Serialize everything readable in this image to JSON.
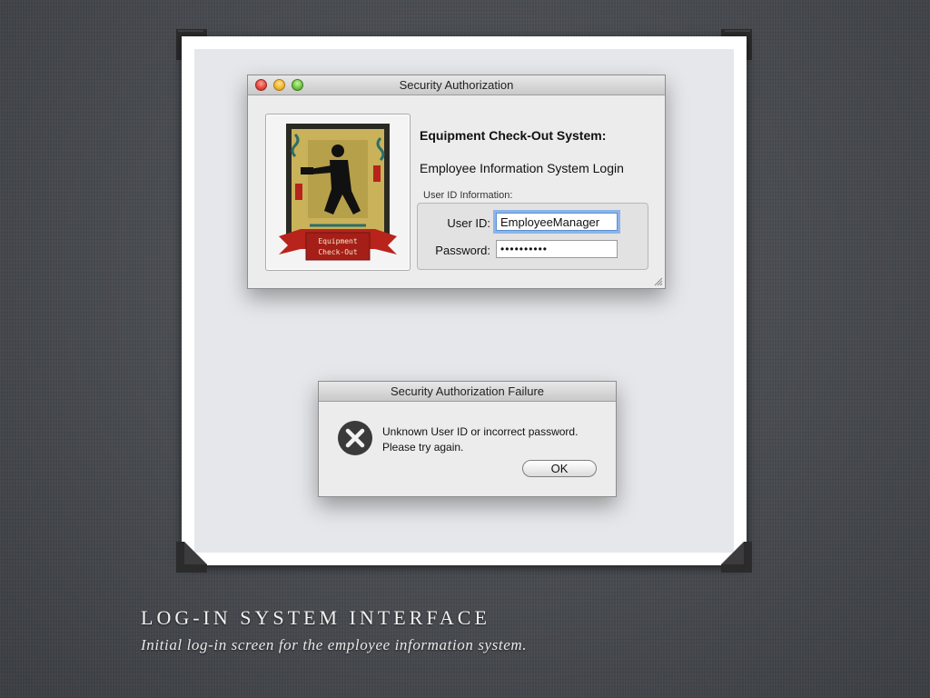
{
  "colors": {
    "background": "#4a4d52",
    "frame": "#ffffff",
    "screen": "#e6e7ea",
    "focus_ring": "#8cb4ea",
    "error_icon": "#3a3a3a",
    "logo_ribbon": "#b8231b",
    "logo_panel": "#c9b25a"
  },
  "login_window": {
    "title": "Security Authorization",
    "logo_line1": "Equipment",
    "logo_line2": "Check-Out",
    "heading": "Equipment Check-Out System:",
    "subheading": "Employee Information System Login",
    "group_label": "User ID Information:",
    "user_id_label": "User ID:",
    "user_id_value": "EmployeeManager",
    "password_label": "Password:",
    "password_value": "••••••••••"
  },
  "alert": {
    "title": "Security Authorization Failure",
    "icon": "error-x-icon",
    "message_line1": "Unknown User ID or incorrect password.",
    "message_line2": "Please try again.",
    "ok_label": "OK"
  },
  "caption": {
    "title": "LOG-IN SYSTEM INTERFACE",
    "subtitle": "Initial log-in screen for the employee information system."
  }
}
